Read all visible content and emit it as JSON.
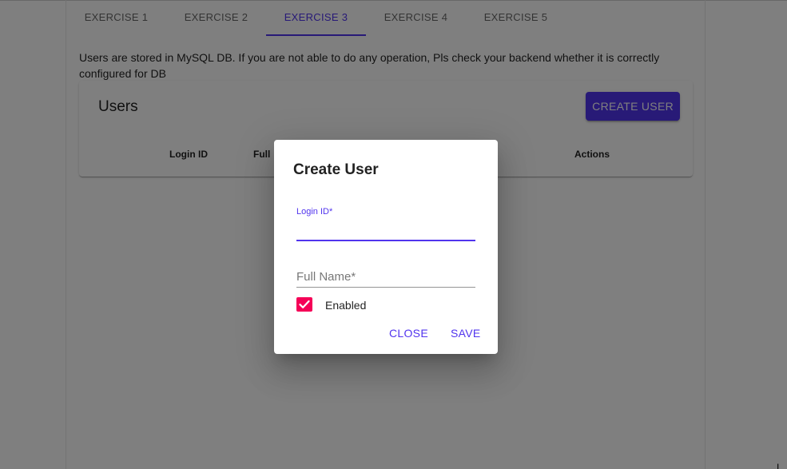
{
  "tabs": [
    {
      "label": "EXERCISE 1"
    },
    {
      "label": "EXERCISE 2"
    },
    {
      "label": "EXERCISE 3"
    },
    {
      "label": "EXERCISE 4"
    },
    {
      "label": "EXERCISE 5"
    }
  ],
  "active_tab_index": 2,
  "info_text": "Users are stored in MySQL DB. If you are not able to do any operation, Pls check your backend whether it is correctly configured for DB",
  "users_card": {
    "title": "Users",
    "create_button": "CREATE USER",
    "columns": {
      "login_id": "Login ID",
      "full_name_partial": "Full",
      "actions": "Actions"
    }
  },
  "dialog": {
    "title": "Create User",
    "login_field": {
      "label": "Login ID*",
      "value": ""
    },
    "fullname_field": {
      "placeholder": "Full Name*",
      "value": ""
    },
    "enabled_checkbox": {
      "label": "Enabled",
      "checked": true
    },
    "close_button": "CLOSE",
    "save_button": "SAVE"
  },
  "colors": {
    "primary": "#5134ee",
    "secondary": "#f50057",
    "backdrop": "rgba(0,0,0,0.5)"
  },
  "icons": {
    "checkbox_check": "check-icon"
  }
}
